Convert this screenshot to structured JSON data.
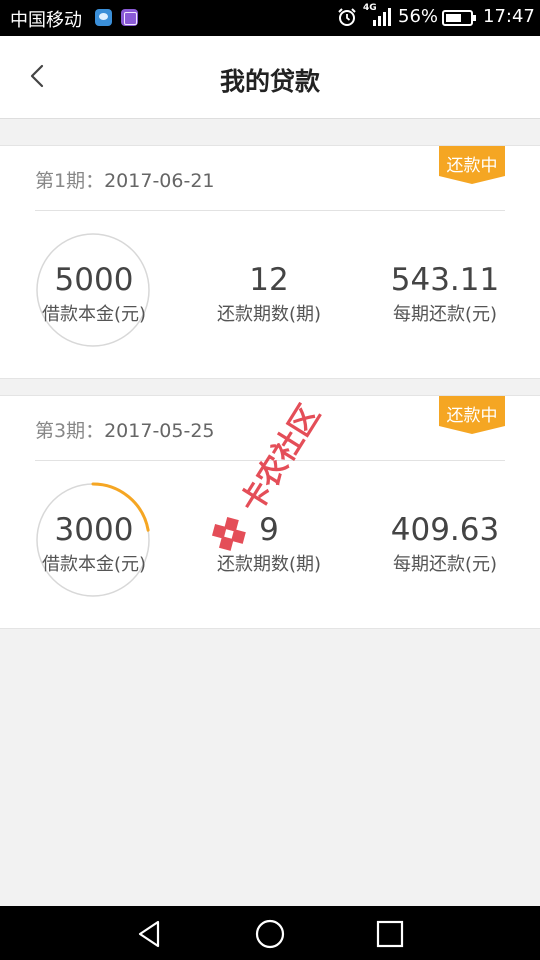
{
  "status_bar": {
    "carrier": "中国移动",
    "network": "4G",
    "battery_percent": "56%",
    "battery_level": 0.56,
    "time": "17:47",
    "icons": [
      "message-app-icon",
      "gallery-app-icon",
      "alarm-icon",
      "signal-icon",
      "battery-icon"
    ]
  },
  "header": {
    "title": "我的贷款",
    "back_icon": "chevron-left-icon"
  },
  "loans": [
    {
      "period_label": "第1期：",
      "date": "2017-06-21",
      "status": "还款中",
      "principal": "5000",
      "principal_label": "借款本金(元)",
      "term": "12",
      "term_label": "还款期数(期)",
      "installment": "543.11",
      "installment_label": "每期还款(元)",
      "progress": 0
    },
    {
      "period_label": "第3期：",
      "date": "2017-05-25",
      "status": "还款中",
      "principal": "3000",
      "principal_label": "借款本金(元)",
      "term": "9",
      "term_label": "还款期数(期)",
      "installment": "409.63",
      "installment_label": "每期还款(元)",
      "progress": 0.222
    }
  ],
  "watermark": {
    "text": "卡农社区"
  },
  "colors": {
    "accent": "#f5a623",
    "ring_track": "#d8d8d8",
    "background": "#f2f2f2",
    "watermark": "#e0303c"
  },
  "nav_bar": {
    "icons": [
      "back-triangle-icon",
      "home-circle-icon",
      "recent-square-icon"
    ]
  }
}
